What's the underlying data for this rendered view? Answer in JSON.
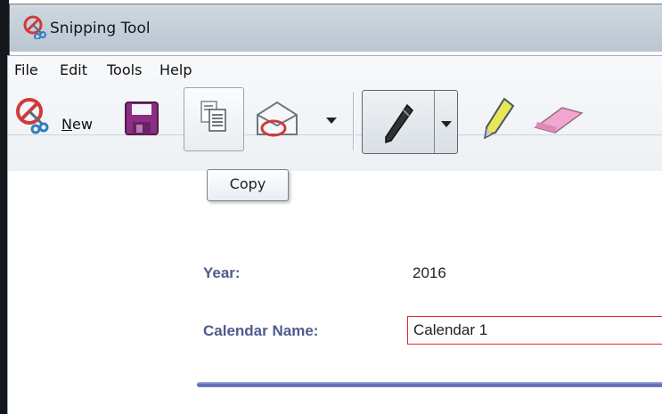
{
  "window": {
    "title": "Snipping Tool"
  },
  "menu": {
    "items": [
      "File",
      "Edit",
      "Tools",
      "Help"
    ]
  },
  "toolbar": {
    "new_mnemonic": "N",
    "new_rest": "ew",
    "icons": {
      "new": "scissors-icon",
      "save": "floppy-disk-icon",
      "copy": "copy-icon",
      "send": "envelope-icon",
      "pen": "pen-icon",
      "highlighter": "highlighter-icon",
      "eraser": "eraser-icon"
    }
  },
  "tooltip": {
    "text": "Copy"
  },
  "form": {
    "year_label": "Year:",
    "year_value": "2016",
    "calendar_name_label": "Calendar Name:",
    "calendar_name_value": "Calendar 1"
  },
  "colors": {
    "label": "#4f5b8e",
    "input_border": "#e02a2a",
    "bar": "#5764b1"
  }
}
